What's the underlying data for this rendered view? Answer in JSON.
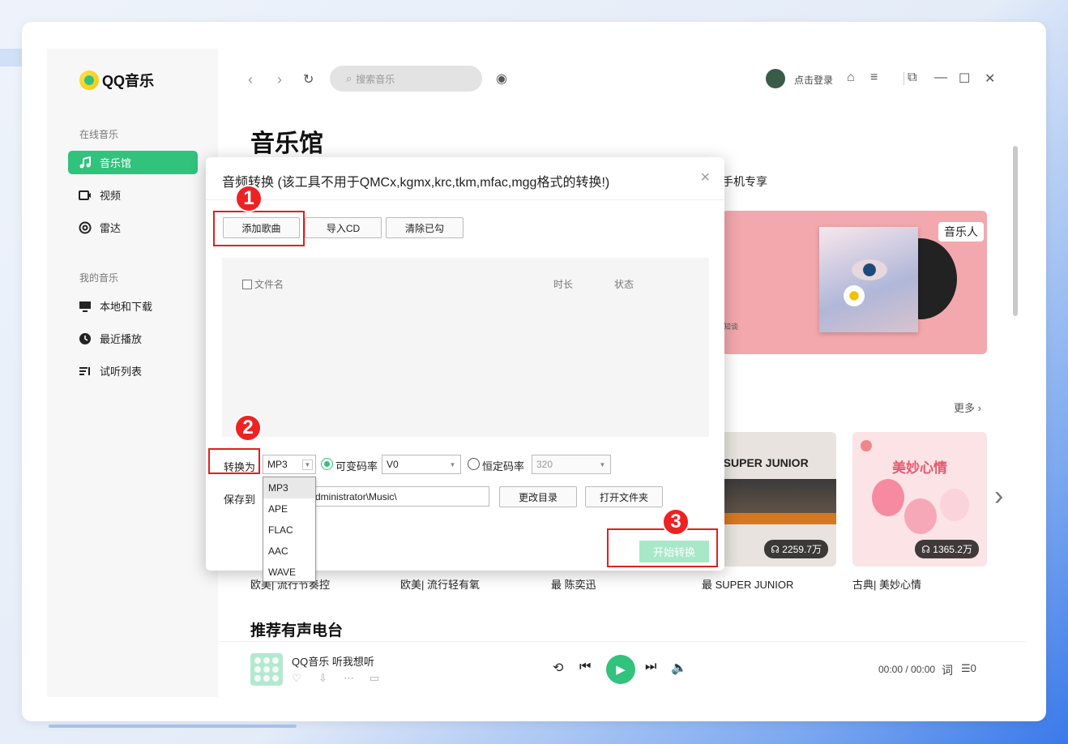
{
  "app": {
    "name": "QQ音乐"
  },
  "sidebar": {
    "online_label": "在线音乐",
    "online_items": [
      {
        "label": "音乐馆",
        "icon": "music-note-icon",
        "active": true
      },
      {
        "label": "视频",
        "icon": "video-icon"
      },
      {
        "label": "雷达",
        "icon": "radar-icon"
      }
    ],
    "my_label": "我的音乐",
    "my_items": [
      {
        "label": "本地和下载",
        "icon": "monitor-icon"
      },
      {
        "label": "最近播放",
        "icon": "clock-icon"
      },
      {
        "label": "试听列表",
        "icon": "playlist-icon"
      }
    ]
  },
  "topbar": {
    "search_placeholder": "搜索音乐",
    "login": "点击登录"
  },
  "main": {
    "title": "音乐馆",
    "tab_partial": "手机专享",
    "banner": {
      "badge": "音乐人",
      "small_text": "知谈"
    },
    "more": "更多",
    "cards": [
      {
        "caption": "欧美| 流行节奏控"
      },
      {
        "caption": "欧美| 流行轻有氧"
      },
      {
        "caption": "最 陈奕迅"
      },
      {
        "caption": "最 SUPER JUNIOR",
        "title": "最·SUPER JUNIOR",
        "plays": "2259.7万"
      },
      {
        "caption": "古典| 美妙心情",
        "title": "美妙心情",
        "plays": "1365.2万"
      }
    ],
    "section2": "推荐有声电台"
  },
  "player": {
    "song": "QQ音乐 听我想听",
    "time": "00:00 / 00:00",
    "lyric": "词",
    "queue_count": "0"
  },
  "dialog": {
    "title": "音频转换 (该工具不用于QMCx,kgmx,krc,tkm,mfac,mgg格式的转换!)",
    "buttons": {
      "add": "添加歌曲",
      "import_cd": "导入CD",
      "clear": "清除已勾"
    },
    "columns": {
      "filename": "文件名",
      "duration": "时长",
      "status": "状态"
    },
    "convert_label": "转换为",
    "format": "MP3",
    "variable_label": "可变码率",
    "variable_value": "V0",
    "constant_label": "恒定码率",
    "constant_value": "320",
    "save_label": "保存到",
    "save_path": "dministrator\\Music\\",
    "change_dir": "更改目录",
    "open_folder": "打开文件夹",
    "start": "开始转换",
    "format_options": [
      "MP3",
      "APE",
      "FLAC",
      "AAC",
      "WAVE"
    ]
  },
  "annotations": [
    "1",
    "2",
    "3"
  ],
  "colors": {
    "accent": "#31c27c",
    "annotation": "#e0201c"
  }
}
